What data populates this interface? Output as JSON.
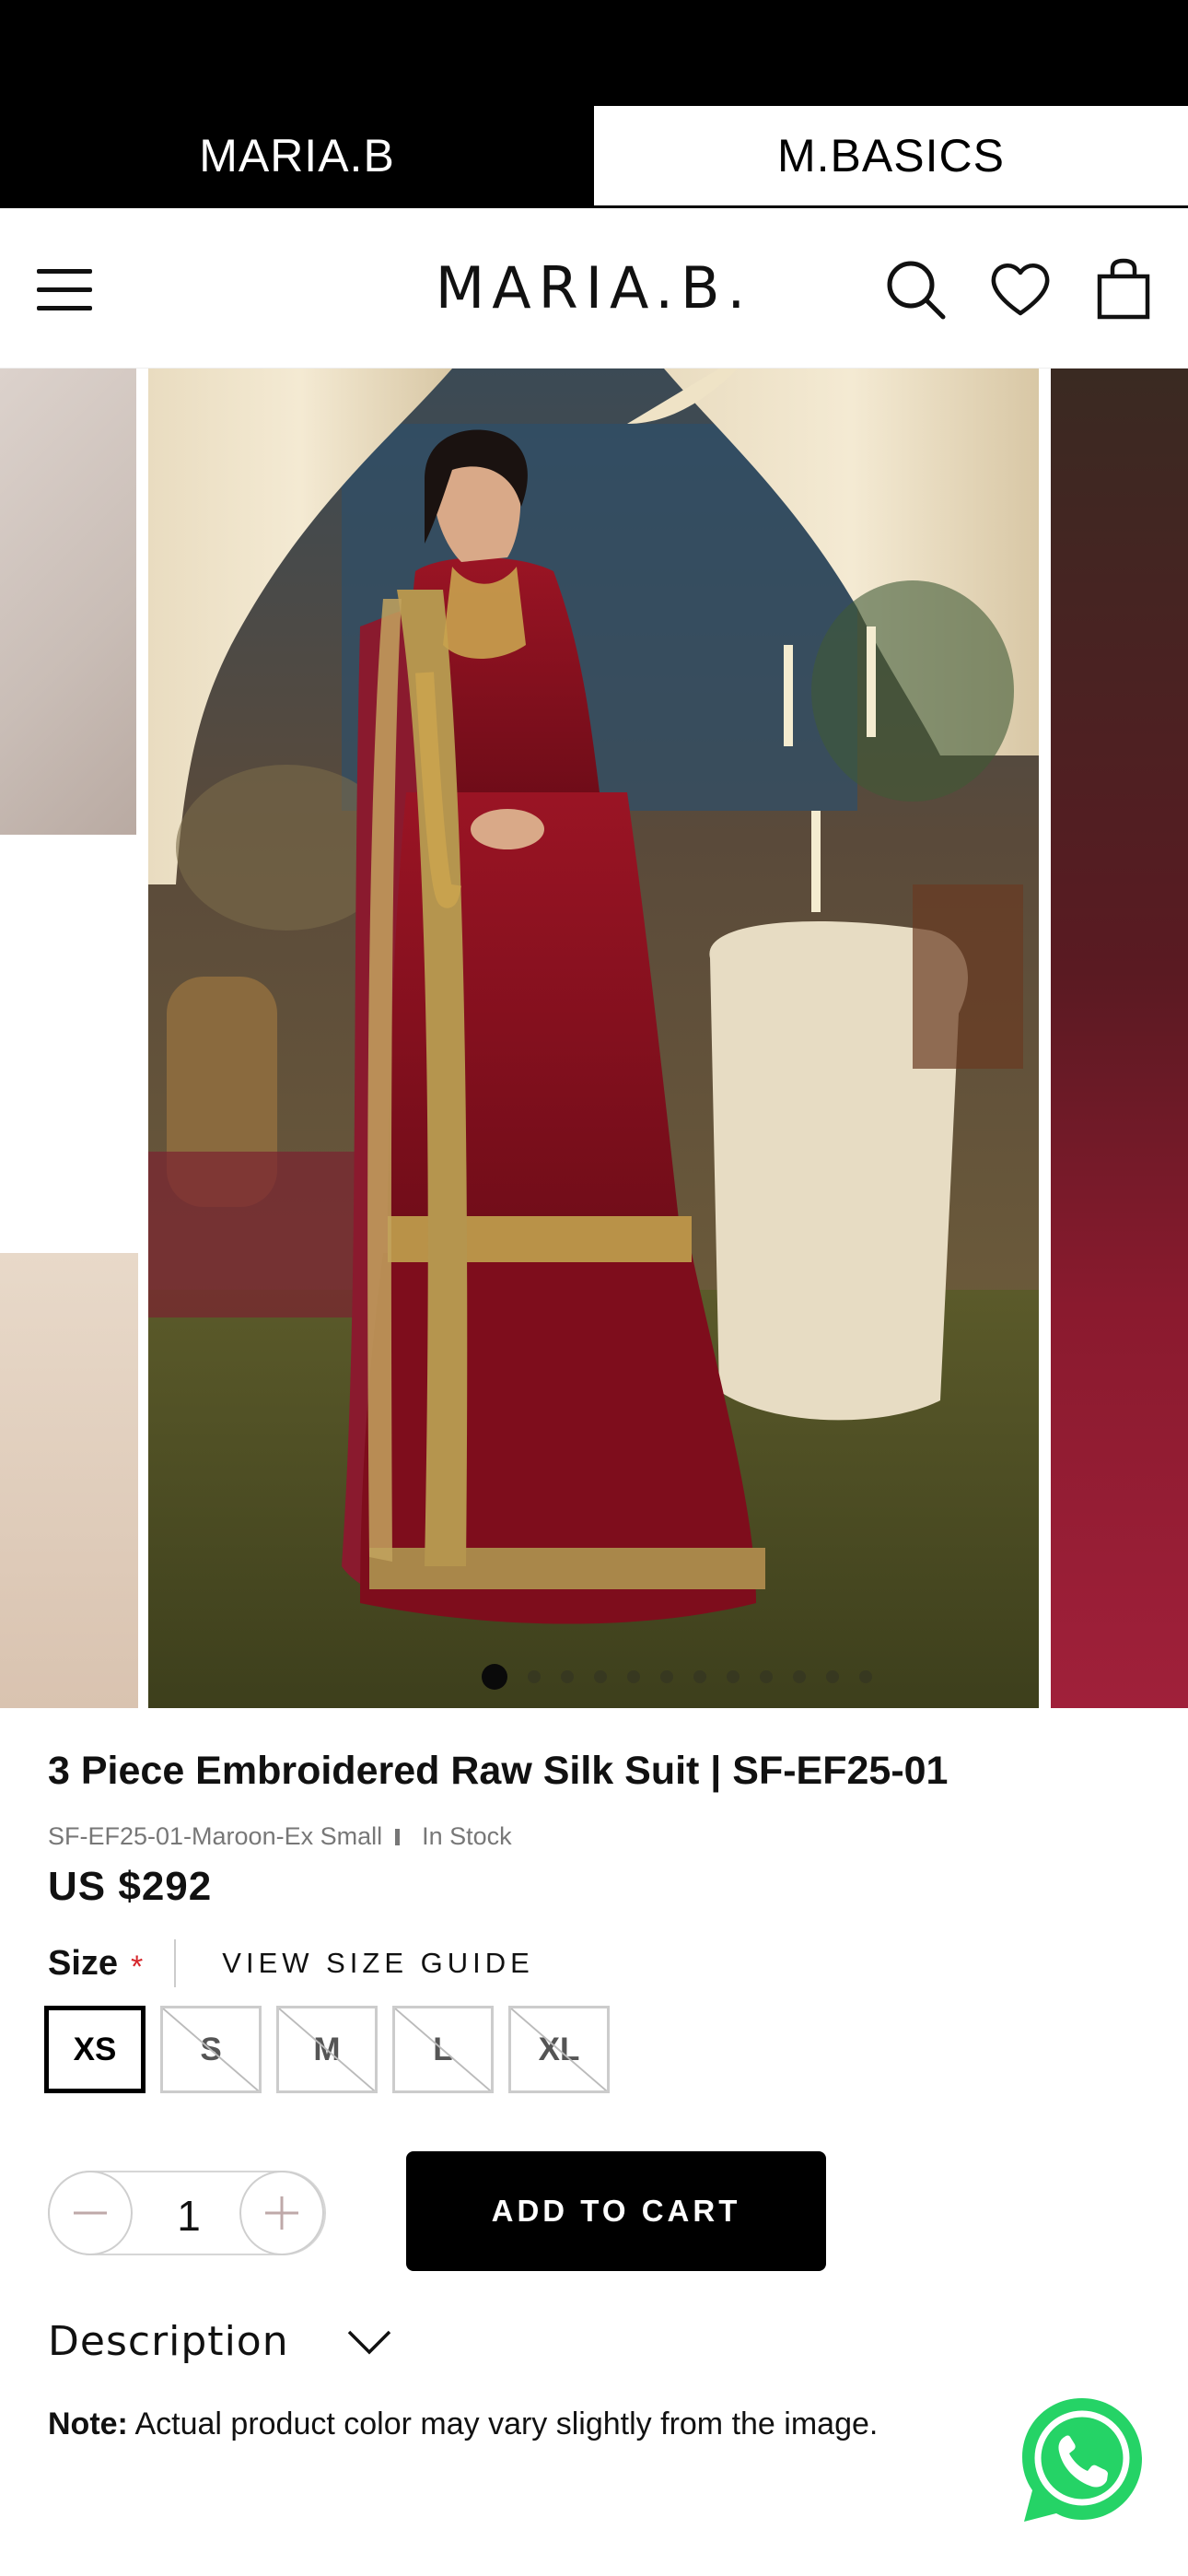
{
  "brand_tabs": [
    {
      "label": "MARIA.B",
      "active": true
    },
    {
      "label": "M.BASICS",
      "active": false
    }
  ],
  "header": {
    "logo": "MARIA.B.",
    "icons": [
      "menu-icon",
      "search-icon",
      "heart-icon",
      "shopping-bag-icon"
    ]
  },
  "gallery": {
    "slide_count": 12,
    "active_slide": 1,
    "zoom_icon": "zoom-icon"
  },
  "product": {
    "title": "3 Piece Embroidered Raw Silk Suit | SF-EF25-01",
    "sku": "SF-EF25-01-Maroon-Ex Small",
    "stock": "In Stock",
    "price": "US $292"
  },
  "size": {
    "label": "Size",
    "required_mark": "*",
    "guide_label": "VIEW SIZE GUIDE",
    "options": [
      {
        "label": "XS",
        "selected": true,
        "available": true
      },
      {
        "label": "S",
        "selected": false,
        "available": false
      },
      {
        "label": "M",
        "selected": false,
        "available": false
      },
      {
        "label": "L",
        "selected": false,
        "available": false
      },
      {
        "label": "XL",
        "selected": false,
        "available": false
      }
    ]
  },
  "quantity": {
    "value": "1"
  },
  "cart": {
    "add_label": "ADD TO CART"
  },
  "description": {
    "title": "Description",
    "note_label": "Note:",
    "note_text": " Actual product color may vary slightly from the image."
  },
  "colors": {
    "black": "#000000",
    "required": "#d6272c",
    "whatsapp": "#25d366",
    "maroon": "#8e1424"
  }
}
